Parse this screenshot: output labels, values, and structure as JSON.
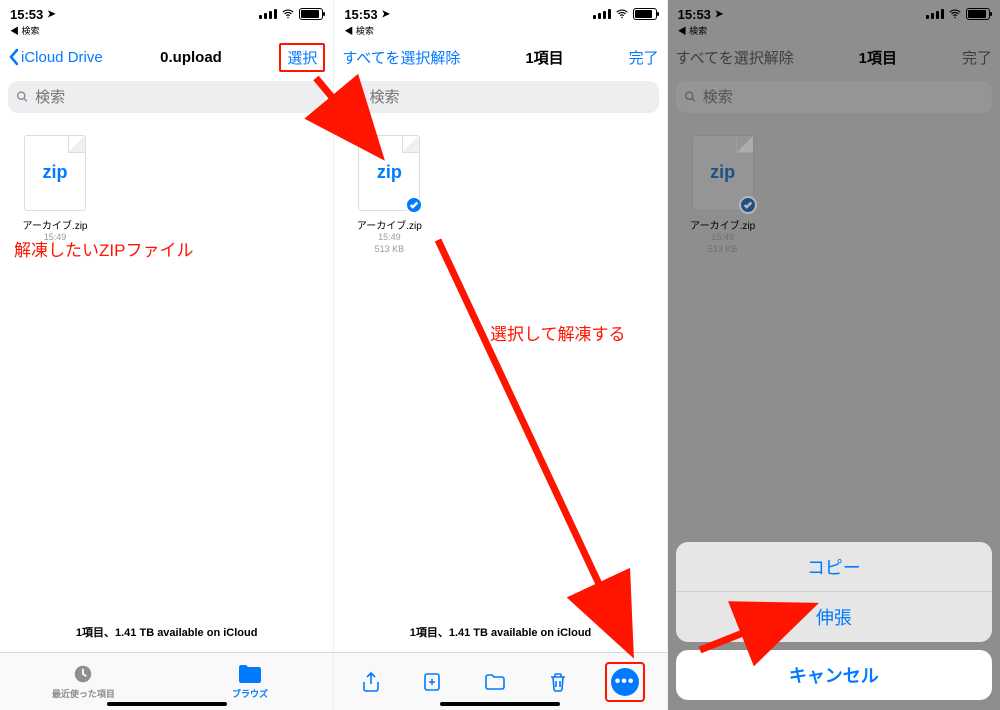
{
  "status": {
    "time": "15:53",
    "back_app": "◀ 検索"
  },
  "pane1": {
    "back_label": "iCloud Drive",
    "title": "0.upload",
    "select_label": "選択",
    "search_placeholder": "検索",
    "file": {
      "zip_label": "zip",
      "name": "アーカイブ.zip",
      "time": "15:49"
    },
    "annotation": "解凍したいZIPファイル",
    "bottom_info": "1項目、1.41 TB available on iCloud",
    "tab_recent": "最近使った項目",
    "tab_browse": "ブラウズ"
  },
  "pane2": {
    "deselect_label": "すべてを選択解除",
    "count_label": "1項目",
    "done_label": "完了",
    "search_placeholder": "検索",
    "file": {
      "zip_label": "zip",
      "name": "アーカイブ.zip",
      "time": "15:49",
      "size": "513 KB"
    },
    "annotation": "選択して解凍する",
    "bottom_info": "1項目、1.41 TB available on iCloud",
    "more_glyph": "•••"
  },
  "pane3": {
    "deselect_label": "すべてを選択解除",
    "count_label": "1項目",
    "done_label": "完了",
    "search_placeholder": "検索",
    "file": {
      "zip_label": "zip",
      "name": "アーカイブ.zip",
      "time": "15:49",
      "size": "513 KB"
    },
    "sheet": {
      "copy": "コピー",
      "expand": "伸張",
      "cancel": "キャンセル"
    }
  }
}
